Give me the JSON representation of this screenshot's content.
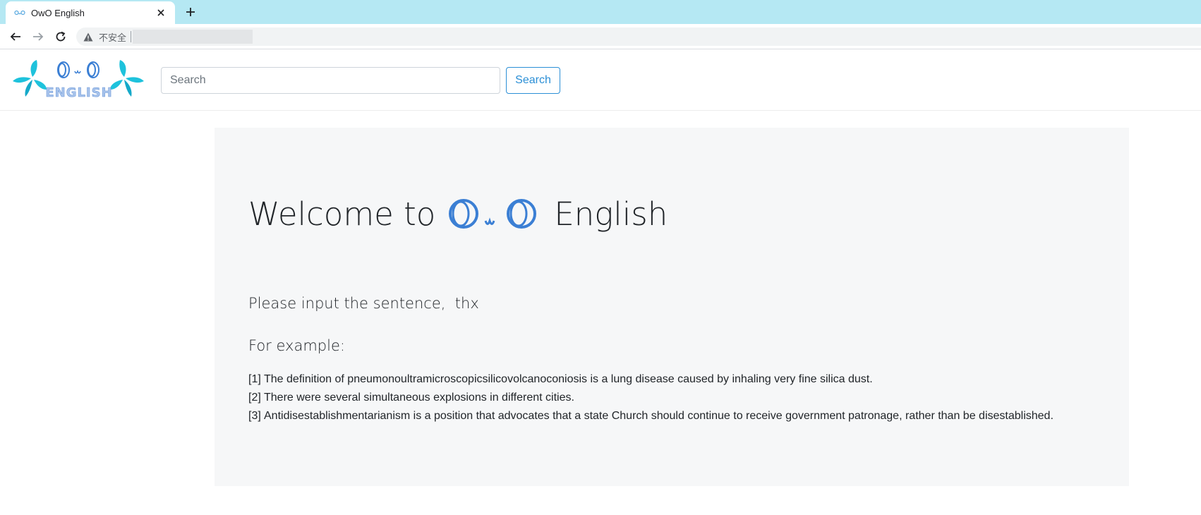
{
  "browser": {
    "tab_title": "OwO English",
    "tab_favicon": "owo-favicon-icon",
    "address_security": "不安全"
  },
  "header": {
    "search_placeholder": "Search",
    "search_button": "Search",
    "logo_name": "owo-english-logo"
  },
  "main": {
    "welcome_prefix": "Welcome to",
    "welcome_suffix": "English",
    "prompt": "Please input the sentence,  thx",
    "example_heading": "For example:",
    "examples": [
      {
        "num": "[1]",
        "text": "The definition of pneumonoultramicroscopicsilicovolcanoconiosis is a lung disease caused by inhaling very fine silica dust."
      },
      {
        "num": "[2]",
        "text": "There were several simultaneous explosions in different cities."
      },
      {
        "num": "[3]",
        "text": "Antidisestablishmentarianism is a position that advocates that a state Church should continue to receive government patronage, rather than be disestablished."
      }
    ]
  },
  "colors": {
    "tabbar": "#b5e8f3",
    "accent": "#2b8fd6",
    "logo_leaf": "#1ec2dc",
    "jumbotron": "#f6f7f8"
  }
}
